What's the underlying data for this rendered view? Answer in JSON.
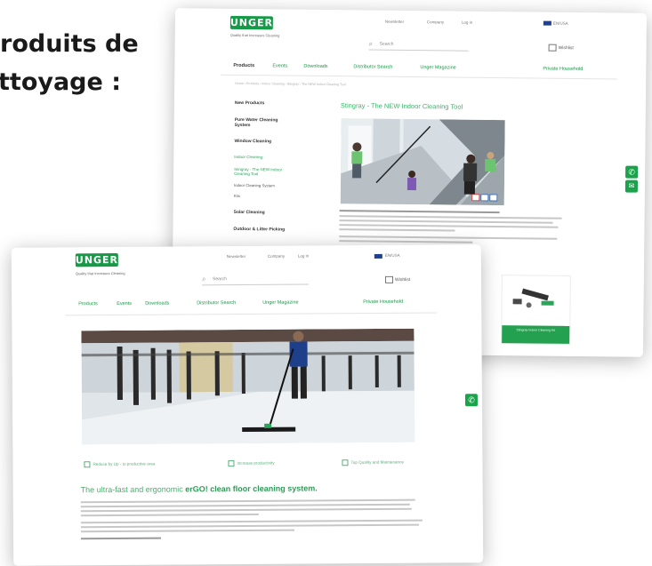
{
  "heading": {
    "line1": "roduits de",
    "line2": "ttoyage :"
  },
  "back": {
    "logo": "UNGER",
    "tagline": "Quality that Increases Cleaning",
    "toplinks": [
      "Newsletter",
      "Company",
      "Log in"
    ],
    "language": "EN/USA",
    "search_placeholder": "Search",
    "mylist": "Wishlist",
    "nav": [
      "Products",
      "Events",
      "Downloads",
      "Distributor Search",
      "Unger Magazine",
      "Private Household"
    ],
    "breadcrumb": "Home › Products › Indoor Cleaning › Stingray › The NEW Indoor Cleaning Tool",
    "sidebar": [
      {
        "label": "New Products",
        "style": "b"
      },
      {
        "label": "Pure Water Cleaning System",
        "style": "b"
      },
      {
        "label": "Window Cleaning",
        "style": "b"
      },
      {
        "label": "Indoor Cleaning",
        "style": "g"
      },
      {
        "label": "Stingray - The NEW Indoor Cleaning Tool",
        "style": "g"
      },
      {
        "label": "Indoor Cleaning System",
        "style": "s"
      },
      {
        "label": "Kits",
        "style": "s"
      },
      {
        "label": "Solar Cleaning",
        "style": "b"
      },
      {
        "label": "Outdoor & Litter Picking",
        "style": "b"
      }
    ],
    "page_title": "Stingray - The NEW Indoor Cleaning Tool",
    "product_card_label": "Stingray Indoor Cleaning Kit"
  },
  "front": {
    "logo": "UNGER",
    "tagline": "Quality that Increases Cleaning",
    "toplinks": [
      "Newsletter",
      "Company",
      "Log in"
    ],
    "language": "EN/USA",
    "search_placeholder": "Search",
    "mylist": "Wishlist",
    "nav": [
      "Products",
      "Events",
      "Downloads",
      "Distributor Search",
      "Unger Magazine",
      "Private Household"
    ],
    "features": [
      "Reduce by Up - to productive area",
      "Increase productivity",
      "Top Quality and Maintenance"
    ],
    "headline_pre": "The ultra-fast and ergonomic",
    "headline_bold": "erGO! clean floor cleaning system."
  },
  "colors": {
    "brand_green": "#169a47",
    "light_green": "#47b06c"
  },
  "icons": {
    "call": "phone-icon",
    "mail": "mail-icon",
    "search": "search-icon"
  }
}
